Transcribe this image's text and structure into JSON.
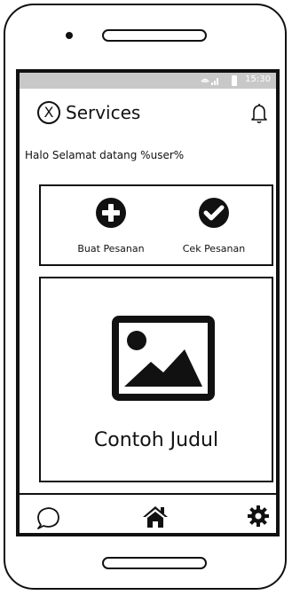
{
  "statusbar": {
    "time": "15:30"
  },
  "header": {
    "logo_text": "X",
    "title": "Services"
  },
  "welcome": {
    "text": "Halo Selamat datang %user%"
  },
  "actions": {
    "create_label": "Buat Pesanan",
    "check_label": "Cek Pesanan"
  },
  "content_card": {
    "title": "Contoh Judul"
  },
  "icons": {
    "notifications": "bell-icon",
    "create": "plus-circle-icon",
    "check": "check-circle-icon",
    "image": "image-icon",
    "chat": "chat-bubble-icon",
    "home": "home-icon",
    "settings": "gear-icon"
  }
}
